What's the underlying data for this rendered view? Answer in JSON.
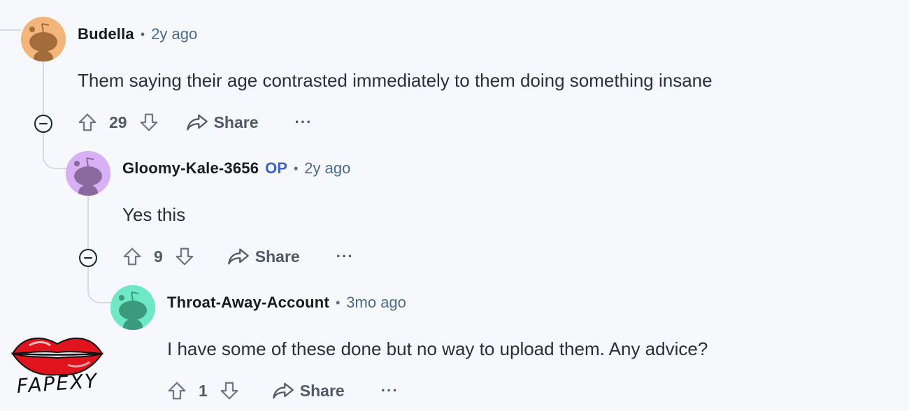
{
  "comments": [
    {
      "username": "Budella",
      "op_badge": "",
      "time": "2y ago",
      "body": "Them saying their age contrasted immediately to them doing something insane",
      "score": "29",
      "share_label": "Share",
      "more_label": "···",
      "avatar_color": "#f3b57a",
      "avatar_dark": "#a36c3b"
    },
    {
      "username": "Gloomy-Kale-3656",
      "op_badge": "OP",
      "time": "2y ago",
      "body": "Yes this",
      "score": "9",
      "share_label": "Share",
      "more_label": "···",
      "avatar_color": "#d8b0f5",
      "avatar_dark": "#8a6a9e"
    },
    {
      "username": "Throat-Away-Account",
      "op_badge": "",
      "time": "3mo ago",
      "body": "I have some of these done but no way to upload them. Any advice?",
      "score": "1",
      "share_label": "Share",
      "more_label": "···",
      "avatar_color": "#6ee8c5",
      "avatar_dark": "#3a9a7c"
    }
  ],
  "watermark": {
    "text": "FAPEXY"
  },
  "icons": {
    "upvote": "upvote-icon",
    "downvote": "downvote-icon",
    "share": "share-icon",
    "collapse": "collapse-icon"
  }
}
